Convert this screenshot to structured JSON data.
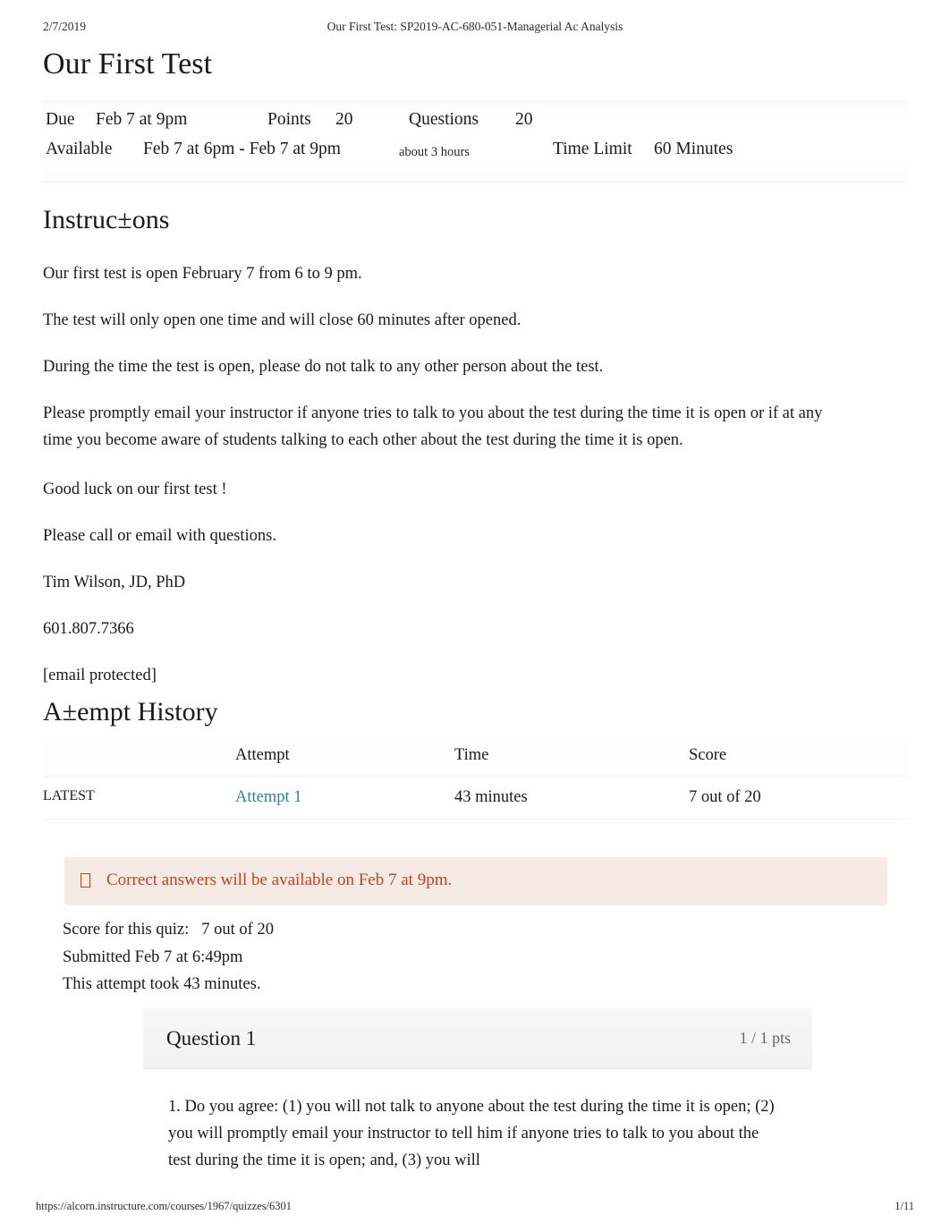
{
  "print_header": {
    "date": "2/7/2019",
    "title": "Our First Test: SP2019-AC-680-051-Managerial Ac Analysis"
  },
  "page_title": "Our First Test",
  "quiz_meta": {
    "due_label": "Due",
    "due_value": "Feb 7 at 9pm",
    "points_label": "Points",
    "points_value": "20",
    "questions_label": "Questions",
    "questions_value": "20",
    "available_label": "Available",
    "available_value": "Feb 7 at 6pm - Feb 7 at 9pm",
    "available_duration": "about 3 hours",
    "time_limit_label": "Time Limit",
    "time_limit_value": "60 Minutes"
  },
  "instructions": {
    "heading": "Instruc±ons",
    "paragraphs": [
      "Our first test is open February 7 from 6 to 9 pm.",
      "The test will only open one time and will close 60 minutes after opened.",
      "During the time the test is open, please do not talk to any other person about the test.",
      "Please promptly email your instructor if anyone tries to talk to you about the test during the time it is open or if at any time you become aware of students talking to each other about the test during the time it is open.",
      "Good luck on our first test !",
      "Please call or email with questions.",
      "Tim Wilson, JD, PhD",
      "601.807.7366",
      "[email protected]"
    ]
  },
  "attempt_history": {
    "heading": "A±empt History",
    "columns": [
      "",
      "Attempt",
      "Time",
      "Score"
    ],
    "rows": [
      {
        "kept": "LATEST",
        "attempt": "Attempt 1",
        "time": "43 minutes",
        "score": "7 out of 20"
      }
    ]
  },
  "alert": {
    "icon": "info-icon",
    "message": "Correct answers will be available on Feb 7 at 9pm.",
    "text_color": "#c0441f",
    "background_color": "#f6eae5"
  },
  "score_summary": {
    "score_label": "Score for this quiz:",
    "score_value": "7 out of 20",
    "submitted": "Submitted Feb 7 at 6:49pm",
    "duration": "This attempt took 43 minutes."
  },
  "question": {
    "title": "Question 1",
    "points": "1 / 1 pts",
    "text": "1. Do you agree: (1) you will not talk to anyone about the test during the time it is open; (2) you will promptly email your instructor to tell him if anyone tries to talk to you about the test during the time it is open; and, (3) you will"
  },
  "print_footer": {
    "url": "https://alcorn.instructure.com/courses/1967/quizzes/6301",
    "page": "1/11"
  },
  "colors": {
    "link": "#2a7fa8",
    "alert_text": "#c0441f",
    "alert_bg": "#f6eae5",
    "muted": "#666666"
  }
}
